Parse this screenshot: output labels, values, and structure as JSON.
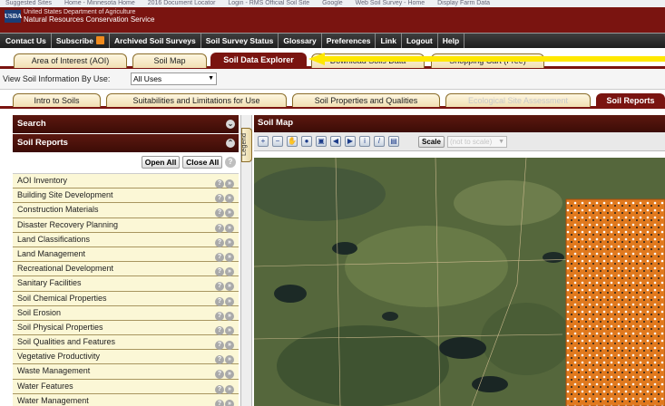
{
  "browser": {
    "favorites": [
      "Suggested Sites",
      "Home - Minnesota Home",
      "2016 Document Locator",
      "Login - RMS Official Soil Site",
      "Google",
      "Web Soil Survey - Home",
      "Display Farm Data"
    ]
  },
  "header": {
    "logo": "USDA",
    "agency_line1": "United States Department of Agriculture",
    "agency_line2": "Natural Resources Conservation Service"
  },
  "nav": {
    "items": [
      "Contact Us",
      "Subscribe",
      "Archived Soil Surveys",
      "Soil Survey Status",
      "Glossary",
      "Preferences",
      "Link",
      "Logout",
      "Help"
    ]
  },
  "main_tabs": [
    "Area of Interest (AOI)",
    "Soil Map",
    "Soil Data Explorer",
    "Download Soils Data",
    "Shopping Cart (Free)"
  ],
  "main_tab_active": "Soil Data Explorer",
  "view_by_use": {
    "label": "View Soil Information By Use:",
    "value": "All Uses"
  },
  "sub_tabs": [
    "Intro to Soils",
    "Suitabilities and Limitations for Use",
    "Soil Properties and Qualities",
    "Ecological Site Assessment",
    "Soil Reports"
  ],
  "sub_tab_disabled": "Ecological Site Assessment",
  "sub_tab_active": "Soil Reports",
  "left_panel": {
    "search_title": "Search",
    "reports_title": "Soil Reports",
    "open_all": "Open All",
    "close_all": "Close All",
    "help_glyph": "?",
    "reports": [
      "AOI Inventory",
      "Building Site Development",
      "Construction Materials",
      "Disaster Recovery Planning",
      "Land Classifications",
      "Land Management",
      "Recreational Development",
      "Sanitary Facilities",
      "Soil Chemical Properties",
      "Soil Erosion",
      "Soil Physical Properties",
      "Soil Qualities and Features",
      "Vegetative Productivity",
      "Waste Management",
      "Water Features",
      "Water Management"
    ]
  },
  "legend_label": "Legend",
  "map": {
    "title": "Soil Map",
    "scale_label": "Scale",
    "scale_value": "(not to scale)"
  },
  "colors": {
    "header_maroon": "#7a1410",
    "panel_dark": "#4a120b",
    "list_row_bg": "#fbf7d6",
    "arrow_yellow": "#ffe800",
    "aoi_orange": "#e0791e"
  }
}
